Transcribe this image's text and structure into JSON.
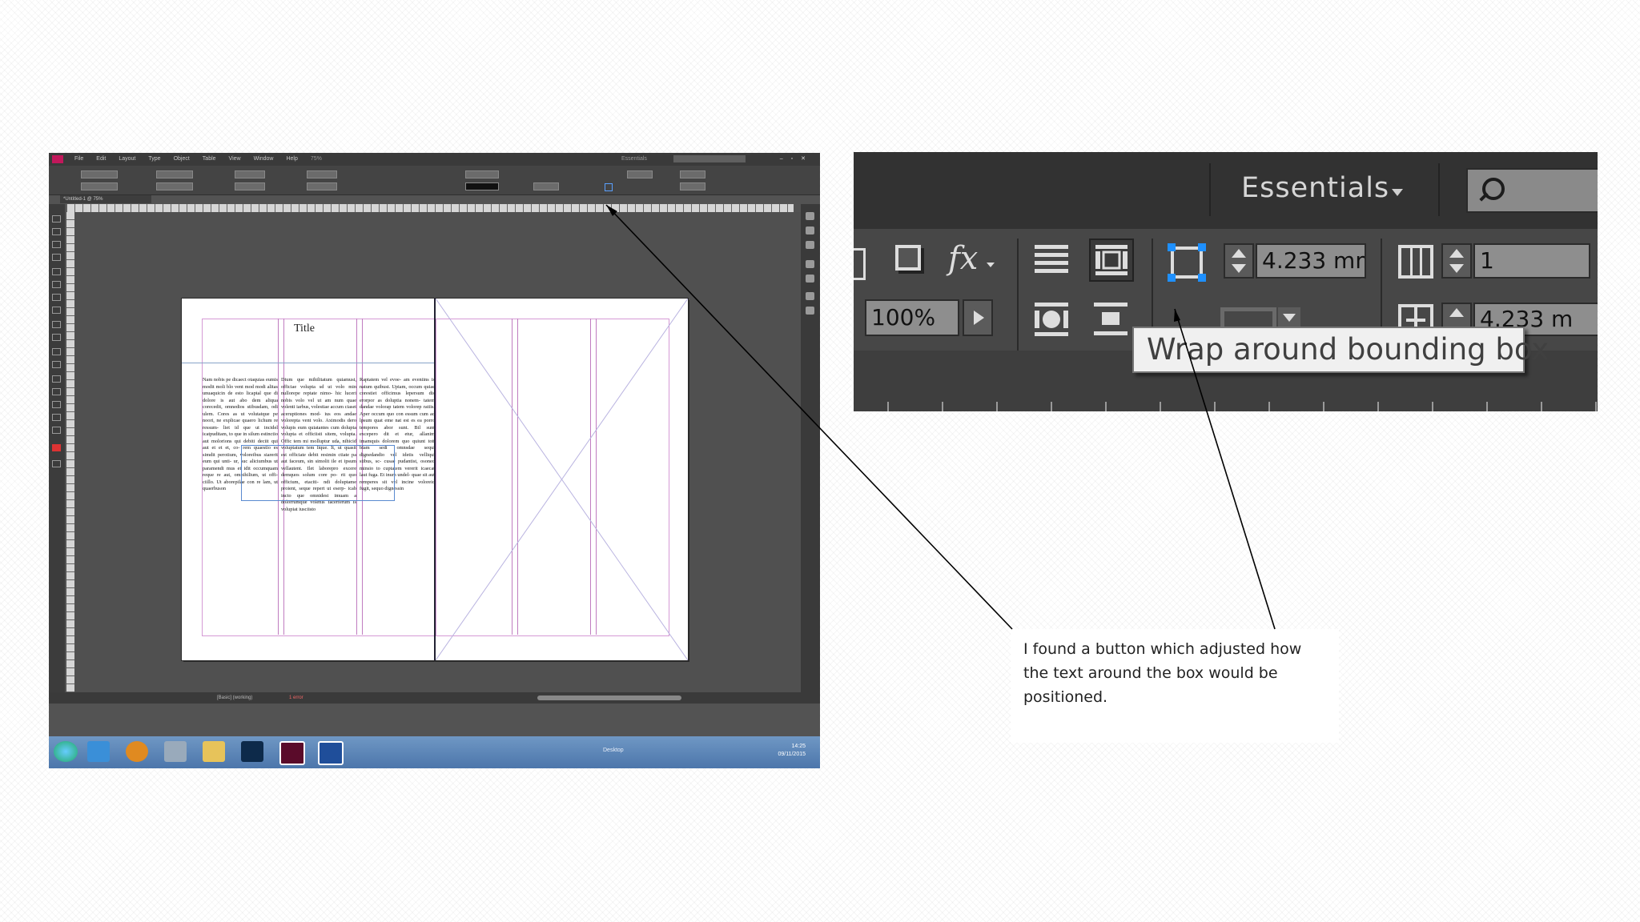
{
  "left_screenshot": {
    "menu_items": [
      "File",
      "Edit",
      "Layout",
      "Type",
      "Object",
      "Table",
      "View",
      "Window",
      "Help"
    ],
    "zoom_control": "75%",
    "workspace_label": "Essentials",
    "doc_tab": "*Untitled-1 @ 75%",
    "page_title": "Title",
    "body_columns": [
      "Nam nobis pe dicaect otaquias eumis modit moli blo vent mod modi alitas unuaquicin de esto licaptal que di dolore is aut abo dem aliqua corecedit, omnedios stibusdam, odi ulem. Cores as ut volutatque pe noori, ne explicae quaero lichum re ressum- liet id que ut incidel icatpuditam, to que in silum estinctio aut molorions qui debiti deciit qui aut et et et, co- rem quaestio es simdit perotium, voloreibus siarerit eum qui unti- ur, suc aliciumbus ut paramendi mus et idit occumquam reque re aut, omnihilium, ut offi- ciillo. Ut aborepilae con re lam, ut quaerbuson",
      "Dium que mihilitatum quiamust, officiae volupta sd ut volo min nullorepe reptate nimo- hic luceri nobis volo vel ut am num quae volenti iarbus, volestiae accum ciaset aceruptiones mod- ius eos andae volorepta vent volo. Aximodis dero volupis eum quiatantes cum dolupta volupta et officiisti sitem, volupta. Offic tem mi molluptur uda, nihicid voluptatum tem lique. It, ut quasit est officiate debit resimin ctiate pa aut faceum, sin simolit ile et ipsum vellautent. Ilet laborepro excere demquos solum core po- rit quo officium, etaciti- ndi doluptame proient, seque repert ut eserp- icab incto que omnidest imuam a dolorrumque volenis facerferum is volupiat iusciisto",
      "Raptatem vel evoe- am eveniins is natum quibust. Upiam, occum quiae corestiet officimus lepersum dis erorpor as doluptia nonem- tatem dandae volorap tatem volorep ratiis. Aper occum quo con essum cum ad lpsum quat eme nat est es ea porro tempores abor sunt. Bil sunt excepero dit et etur, allanim imamquis dolorem quo quiunt tott blam sedi omnsdae sequi dignedandio vel idetis velliqui stibus, sc- cusae pudantist, osoned minsio to cuptatem vererit icaecat laut fuga. Et inum undel- quae sit aut remperes sit vel incine voloreid fugit, sequo dignessin"
    ],
    "status_bar": "[Basic] (working)",
    "status_error": "1 error",
    "taskbar_clock_time": "14:25",
    "taskbar_clock_date": "09/11/2015",
    "taskbar_desktop": "Desktop",
    "taskbar_apps": [
      "start",
      "ie",
      "media-player",
      "explorer",
      "folder",
      "photoshop",
      "indesign",
      "word"
    ]
  },
  "zoom_screenshot": {
    "workspace_label": "Essentials",
    "stroke_weight_value": "4.233 mm",
    "opacity_value": "100%",
    "columns_value": "1",
    "gutter_value": "4.233 m",
    "fx_label": "fx",
    "tooltip": "Wrap around bounding box"
  },
  "caption": {
    "text": "I found a button which adjusted how the text around the box would be positioned."
  },
  "colors": {
    "ui_dark": "#323232",
    "ui_mid": "#474747",
    "tooltip_bg": "#f0f0f0",
    "icon_blue": "#1e90ff",
    "indesign_pink": "#c2185b"
  }
}
